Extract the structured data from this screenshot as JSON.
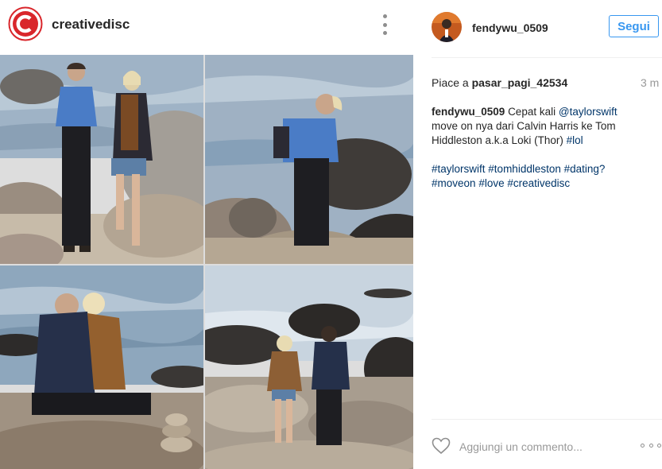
{
  "header": {
    "account_name": "creativedisc",
    "logo_icon": "creativedisc-c-logo",
    "menu_icon": "more-vertical-icon"
  },
  "collage": {
    "photos": [
      {
        "label": "photo-couple-walking-rocks"
      },
      {
        "label": "photo-couple-embracing-rocks"
      },
      {
        "label": "photo-couple-kissing-shore"
      },
      {
        "label": "photo-couple-walking-away"
      }
    ]
  },
  "sidebar": {
    "poster": "fendywu_0509",
    "follow_label": "Segui",
    "likes_prefix": "Piace a",
    "likes_user": "pasar_pagi_42534",
    "time": "3 m",
    "caption": {
      "user": "fendywu_0509",
      "text1": "Cepat kali",
      "mention": "@taylorswift",
      "text2": "move on nya dari Calvin Harris ke Tom Hiddleston a.k.a Loki (Thor)",
      "tag_lol": "#lol",
      "tags_line1": [
        "#taylorswift",
        "#tomhiddleston",
        "#dating?"
      ],
      "tags_line2": [
        "#moveon",
        "#love",
        "#creativedisc"
      ]
    },
    "comment_placeholder": "Aggiungi un commento..."
  },
  "colors": {
    "accent": "#3897f0",
    "link": "#003569",
    "logo_red": "#d9262b"
  }
}
